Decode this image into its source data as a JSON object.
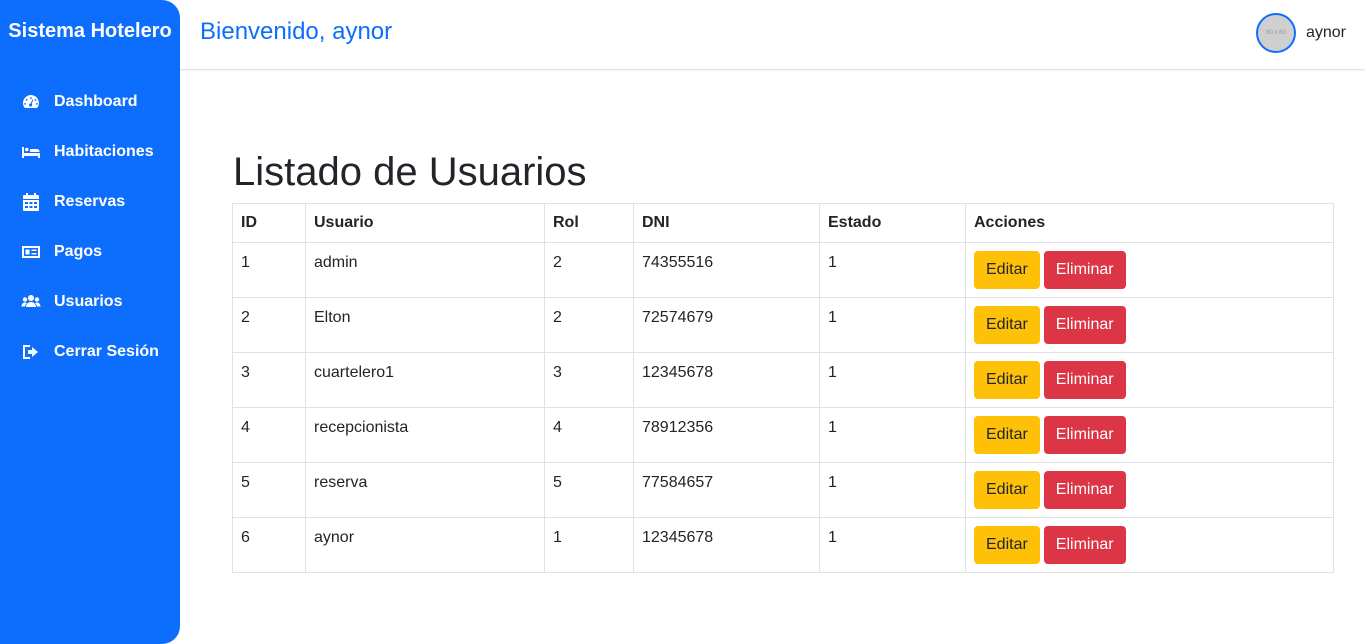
{
  "sidebar": {
    "brand": "Sistema Hotelero",
    "items": [
      {
        "label": "Dashboard",
        "icon": "dashboard-icon"
      },
      {
        "label": "Habitaciones",
        "icon": "bed-icon"
      },
      {
        "label": "Reservas",
        "icon": "calendar-icon"
      },
      {
        "label": "Pagos",
        "icon": "money-icon"
      },
      {
        "label": "Usuarios",
        "icon": "users-icon"
      },
      {
        "label": "Cerrar Sesión",
        "icon": "logout-icon"
      }
    ],
    "color": "#0d6efd"
  },
  "header": {
    "welcome": "Bienvenido, aynor",
    "avatar_text": "80 x 80",
    "user": "aynor"
  },
  "main": {
    "title": "Listado de Usuarios",
    "table": {
      "headers": [
        "ID",
        "Usuario",
        "Rol",
        "DNI",
        "Estado",
        "Acciones"
      ],
      "rows": [
        {
          "id": "1",
          "usuario": "admin",
          "rol": "2",
          "dni": "74355516",
          "estado": "1"
        },
        {
          "id": "2",
          "usuario": "Elton",
          "rol": "2",
          "dni": "72574679",
          "estado": "1"
        },
        {
          "id": "3",
          "usuario": "cuartelero1",
          "rol": "3",
          "dni": "12345678",
          "estado": "1"
        },
        {
          "id": "4",
          "usuario": "recepcionista",
          "rol": "4",
          "dni": "78912356",
          "estado": "1"
        },
        {
          "id": "5",
          "usuario": "reserva",
          "rol": "5",
          "dni": "77584657",
          "estado": "1"
        },
        {
          "id": "6",
          "usuario": "aynor",
          "rol": "1",
          "dni": "12345678",
          "estado": "1"
        }
      ],
      "edit_label": "Editar",
      "delete_label": "Eliminar",
      "edit_color": "#ffc107",
      "delete_color": "#dc3545"
    }
  }
}
